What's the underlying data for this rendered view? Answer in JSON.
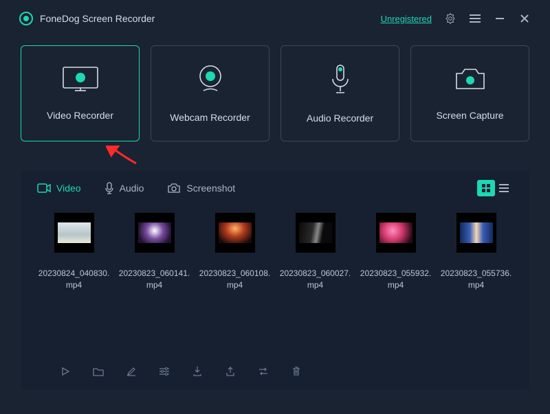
{
  "header": {
    "app_title": "FoneDog Screen Recorder",
    "status_link": "Unregistered"
  },
  "modes": [
    {
      "label": "Video Recorder",
      "icon": "video-recorder-icon",
      "active": true
    },
    {
      "label": "Webcam Recorder",
      "icon": "webcam-icon",
      "active": false
    },
    {
      "label": "Audio Recorder",
      "icon": "microphone-icon",
      "active": false
    },
    {
      "label": "Screen Capture",
      "icon": "camera-icon",
      "active": false
    }
  ],
  "tabs": {
    "video": "Video",
    "audio": "Audio",
    "screenshot": "Screenshot"
  },
  "items": [
    {
      "name": "20230824_040830.mp4"
    },
    {
      "name": "20230823_060141.mp4"
    },
    {
      "name": "20230823_060108.mp4"
    },
    {
      "name": "20230823_060027.mp4"
    },
    {
      "name": "20230823_055932.mp4"
    },
    {
      "name": "20230823_055736.mp4"
    }
  ],
  "colors": {
    "accent": "#1cd8b3",
    "bg": "#1a2332"
  }
}
